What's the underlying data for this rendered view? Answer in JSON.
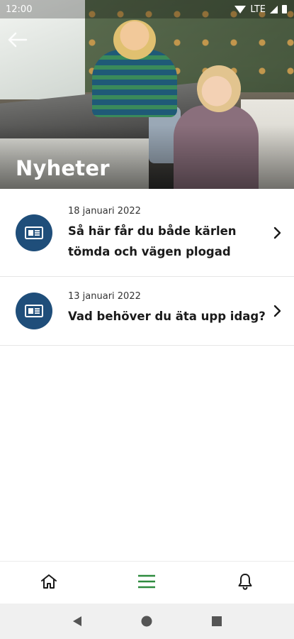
{
  "status_bar": {
    "time": "12:00",
    "network": "LTE",
    "icons": [
      "wifi-icon",
      "signal-icon",
      "battery-icon"
    ]
  },
  "header": {
    "title": "Nyheter",
    "back_icon": "arrow-left-icon"
  },
  "news": [
    {
      "date": "18 januari 2022",
      "headline": "Så här får du både kärlen tömda och vägen plogad",
      "icon": "newspaper-icon"
    },
    {
      "date": "13 januari 2022",
      "headline": "Vad behöver du äta upp idag?",
      "icon": "newspaper-icon"
    }
  ],
  "bottom_nav": {
    "items": [
      {
        "icon": "home-icon",
        "active": false
      },
      {
        "icon": "menu-icon",
        "active": true
      },
      {
        "icon": "bell-icon",
        "active": false
      }
    ],
    "active_color": "#2e8b3e"
  },
  "system_nav": [
    "back-triangle-icon",
    "home-circle-icon",
    "recents-square-icon"
  ],
  "colors": {
    "icon_circle": "#1f4e7a",
    "system_nav_bg": "#f0f0f0"
  }
}
